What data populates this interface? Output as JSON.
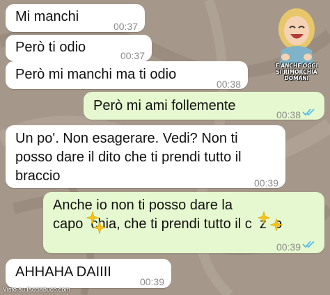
{
  "messages": [
    {
      "direction": "in",
      "text": "Mi manchi",
      "time": "00:37"
    },
    {
      "direction": "in",
      "text": "Però ti odio",
      "time": "00:37"
    },
    {
      "direction": "in",
      "text": "Però mi manchi ma ti odio",
      "time": "00:38"
    },
    {
      "direction": "out",
      "text": "Però mi ami follemente",
      "time": "00:38",
      "status": "read"
    },
    {
      "direction": "in",
      "lines": [
        "Un po'. Non esagerare. Vedi? Non ti",
        "posso dare il dito che ti prendi tutto il",
        "braccio"
      ],
      "time": "00:39"
    },
    {
      "direction": "out",
      "lines": [
        "Anche io non ti posso dare la",
        "capo  chia, che ti prendi tutto il c  z  o"
      ],
      "time": "00:39",
      "status": "read"
    },
    {
      "direction": "in",
      "text": "AHHAHA DAIIII",
      "time": "00:39"
    }
  ],
  "sticker": {
    "icon": "laughing-woman-sticker",
    "lines": [
      "E ANCHE OGGI",
      "SI RIMORCHIA DOMANI"
    ]
  },
  "watermark": {
    "text": "Visto su facciabuco.com"
  },
  "colors": {
    "incoming": "#ffffff",
    "outgoing": "#e6f8cf",
    "read_ticks": "#53bdeb",
    "timestamp": "#8a8a8a"
  },
  "censor_icon": "sparkle-emoji-icon"
}
